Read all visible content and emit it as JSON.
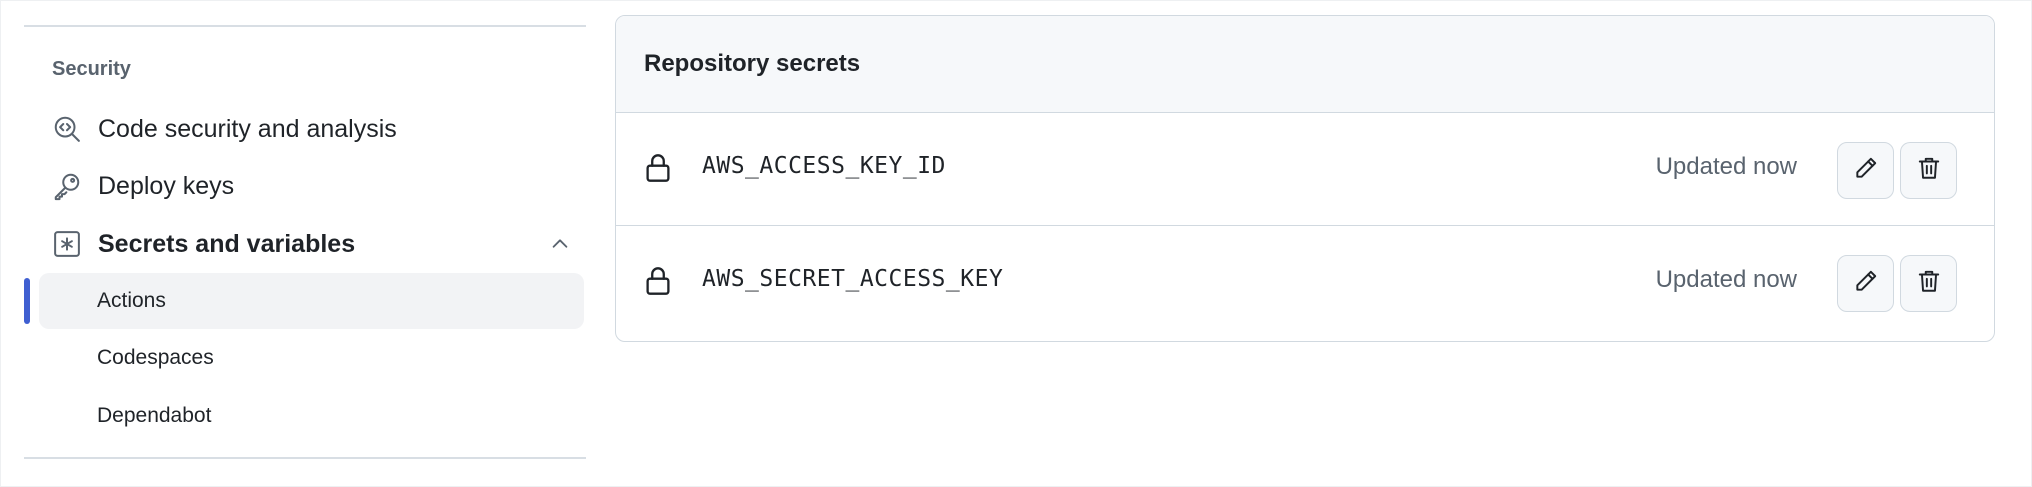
{
  "sidebar": {
    "section_heading": "Security",
    "items": [
      {
        "label": "Code security and analysis",
        "icon": "codescan-icon"
      },
      {
        "label": "Deploy keys",
        "icon": "key-icon"
      },
      {
        "label": "Secrets and variables",
        "icon": "asterisk-icon",
        "expanded": true
      }
    ],
    "sub_items": [
      {
        "label": "Actions",
        "active": true
      },
      {
        "label": "Codespaces",
        "active": false
      },
      {
        "label": "Dependabot",
        "active": false
      }
    ]
  },
  "main": {
    "panel_title": "Repository secrets",
    "secrets": [
      {
        "name": "AWS_ACCESS_KEY_ID",
        "status": "Updated now"
      },
      {
        "name": "AWS_SECRET_ACCESS_KEY",
        "status": "Updated now"
      }
    ]
  },
  "colors": {
    "active_indicator": "#3f5fd1",
    "muted_text": "#59636e",
    "border": "#d1d9e0",
    "header_bg": "#f6f8fa"
  }
}
